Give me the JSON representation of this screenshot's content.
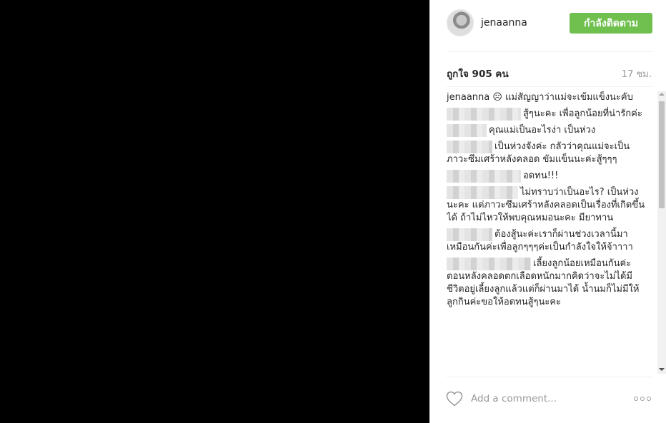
{
  "header": {
    "username": "jenaanna",
    "follow_label": "กำลังติดตาม"
  },
  "stats": {
    "likes": "ถูกใจ 905 คน",
    "time": "17 ชม."
  },
  "comments": [
    {
      "author": "jenaanna",
      "text": " ☹ แม่สัญญาว่าแม่จะเข้มแข็งนะคับ"
    },
    {
      "author": "",
      "blur": 104,
      "text": "สู้ๆนะคะ เพื่อลูกน้อยที่น่ารักค่ะ"
    },
    {
      "author": "",
      "blur": 56,
      "text": "คุณแม่เป็นอะไรง่า เป็นห่วง"
    },
    {
      "author": "",
      "blur": 64,
      "text": "เป็นห่วงจังค่ะ กลัวว่าคุณแม่จะเป็นภาวะซึมเศร้าหลังคลอด ขัมแข็นนะค่ะสู้ๆๆๆ"
    },
    {
      "author": "",
      "blur": 104,
      "text": "อดทน!!!"
    },
    {
      "author": "",
      "blur": 100,
      "text": "ไม่ทราบว่าเป็นอะไร? เป็นห่วงนะคะ แต่ภาวะซึมเศร้าหลังคลอดเป็นเรื่องที่เกิดขึ้นได้ ถ้าไม่ไหวให้พบคุณหมอนะคะ มียาทาน"
    },
    {
      "author": "",
      "blur": 64,
      "text": "ต้องสู้นะค่ะเราก็ผ่านช่วงเวลานี้มาเหมือนกันค่ะเพื่อลูกๆๆๆค่ะเป็นกำลังใจให้จ้าาาา"
    },
    {
      "author": "",
      "blur": 118,
      "text": "เลี้ยงลูกน้อยเหมือนกันค่ะตอนหลังคลอดตกเลือดหนักมากคิดว่าจะไม่ได้มีชีวิตอยู่เลี้ยงลูกแล้วแต่ก็ผ่านมาได้ น้ำนมก็ไม่มีให้ลูกกินค่ะขอให้อดทนสู้ๆนะคะ"
    }
  ],
  "composer": {
    "placeholder": "Add a comment..."
  },
  "icons": {
    "like": "heart-icon",
    "options": "more-options-icon"
  },
  "colors": {
    "follow_button": "#70c050",
    "muted_text": "#999999"
  }
}
